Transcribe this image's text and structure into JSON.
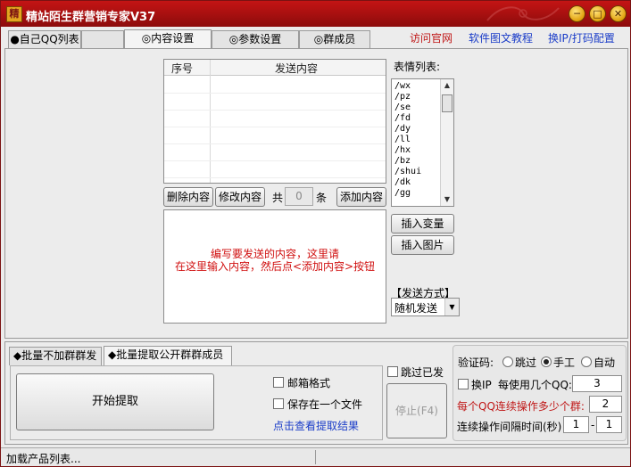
{
  "window": {
    "title": "精站陌生群营销专家V37",
    "app_icon_glyph": "精",
    "controls": {
      "minimize": "─",
      "maximize": "□",
      "close": "✕"
    }
  },
  "tabs": [
    {
      "label": "●自己QQ列表",
      "active": false
    },
    {
      "label": "",
      "active": false
    },
    {
      "label": "◎内容设置",
      "active": true
    },
    {
      "label": "◎参数设置",
      "active": false
    },
    {
      "label": "◎群成员",
      "active": false
    }
  ],
  "links": {
    "official_site": "访问官网",
    "tutorial": "软件图文教程",
    "change_ip": "换IP/打码配置"
  },
  "content_list": {
    "col_index": "序号",
    "col_content": "发送内容",
    "rows": []
  },
  "list_actions": {
    "delete": "删除内容",
    "modify": "修改内容",
    "count_prefix": "共",
    "count_value": "0",
    "count_suffix": "条",
    "add": "添加内容"
  },
  "editor": {
    "hint_line1": "编写要发送的内容，这里请",
    "hint_line2": "在这里输入内容，然后点<添加内容>按钮"
  },
  "emoji_panel": {
    "label": "表情列表:",
    "items": [
      "/wx",
      "/pz",
      "/se",
      "/fd",
      "/dy",
      "/ll",
      "/hx",
      "/bz",
      "/shui",
      "/dk",
      "/gg"
    ]
  },
  "insert_buttons": {
    "variable": "插入变量",
    "image": "插入图片"
  },
  "send_mode": {
    "label": "【发送方式】",
    "value": "随机发送"
  },
  "bottom_tabs": [
    {
      "label": "◆批量不加群群发",
      "active": false
    },
    {
      "label": "◆批量提取公开群群成员",
      "active": true
    }
  ],
  "extract": {
    "start_button": "开始提取",
    "mailbox_format": "邮箱格式",
    "save_one_file": "保存在一个文件",
    "view_result": "点击查看提取结果"
  },
  "skip_sent": "跳过已发",
  "stop_button": "停止(F4)",
  "captcha": {
    "label": "验证码:",
    "options": [
      "跳过",
      "手工",
      "自动"
    ],
    "selected": "手工"
  },
  "change_ip": {
    "label": "换IP",
    "per_qq_label": "每使用几个QQ:",
    "per_qq_value": "3"
  },
  "per_qq_groups": {
    "label": "每个QQ连续操作多少个群:",
    "value": "2"
  },
  "interval": {
    "label": "连续操作间隔时间(秒)",
    "from": "1",
    "separator": "-",
    "to": "1"
  },
  "status": {
    "text": "加载产品列表..."
  },
  "colors": {
    "titlebar": "#b41212",
    "link_red": "#c01818",
    "link_blue": "#1a3cc8",
    "hint_red": "#d01010"
  }
}
